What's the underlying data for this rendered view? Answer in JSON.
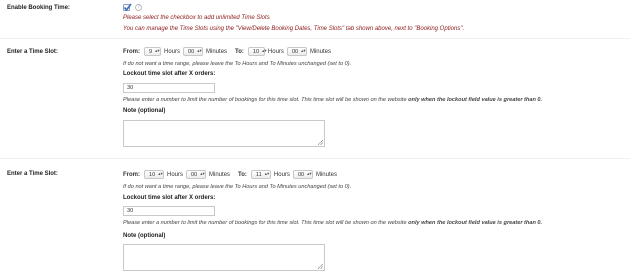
{
  "booking_time": {
    "label": "Enable Booking Time:",
    "checked": true,
    "help_icon": "question-circle-icon",
    "msg1": "Please select the checkbox to add unlimited Time Slots",
    "msg2": "You can manage the Time Slots using the \"View/Delete Booking Dates, Time Slots\" tab shown above, next to \"Booking Options\"."
  },
  "slots": [
    {
      "label": "Enter a Time Slot:",
      "from_label": "From:",
      "from_hours": "9",
      "hours_label": "Hours",
      "from_minutes": "00",
      "minutes_label": "Minutes",
      "to_label": "To:",
      "to_hours": "10",
      "to_minutes": "00",
      "range_note": "If do not want a time range, please leave the To Hours and To Minutes unchanged (set to 0).",
      "lockout_label": "Lockout time slot after X orders:",
      "lockout_value": "30",
      "lockout_note_plain": "Please enter a number to limit the number of bookings for this time slot. This time slot will be shown on the website ",
      "lockout_note_bold": "only when the lockout field value is greater than 0.",
      "note_label": "Note (optional)",
      "note_value": ""
    },
    {
      "label": "Enter a Time Slot:",
      "from_label": "From:",
      "from_hours": "10",
      "hours_label": "Hours",
      "from_minutes": "00",
      "minutes_label": "Minutes",
      "to_label": "To:",
      "to_hours": "11",
      "to_minutes": "00",
      "range_note": "If do not want a time range, please leave the To Hours and To Minutes unchanged (set to 0).",
      "lockout_label": "Lockout time slot after X orders:",
      "lockout_value": "30",
      "lockout_note_plain": "Please enter a number to limit the number of bookings for this time slot. This time slot will be shown on the website ",
      "lockout_note_bold": "only when the lockout field value is greater than 0.",
      "note_label": "Note (optional)",
      "note_value": ""
    }
  ],
  "colors": {
    "message_red": "#8b1a1a",
    "checkbox_blue": "#3a6fb5"
  }
}
